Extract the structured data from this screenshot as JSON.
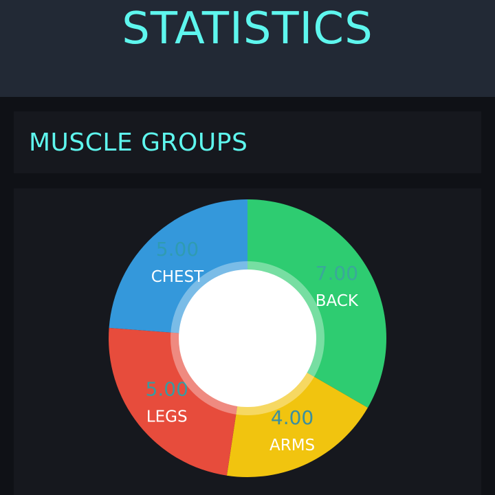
{
  "header": {
    "title": "STATISTICS"
  },
  "section": {
    "title": "MUSCLE GROUPS"
  },
  "chart_data": {
    "type": "pie",
    "style": "donut",
    "categories": [
      "BACK",
      "ARMS",
      "LEGS",
      "CHEST"
    ],
    "values": [
      7.0,
      4.0,
      5.0,
      5.0
    ],
    "value_labels": [
      "7.00",
      "4.00",
      "5.00",
      "5.00"
    ],
    "colors": [
      "#2ecc71",
      "#f1c40f",
      "#e74c3c",
      "#3498db"
    ],
    "value_label_colors": [
      "#3aa89a",
      "#3a8fa0",
      "#3a9aa0",
      "#2f9bb2"
    ],
    "label_color": "#ffffff",
    "center_color": "#ffffff"
  }
}
